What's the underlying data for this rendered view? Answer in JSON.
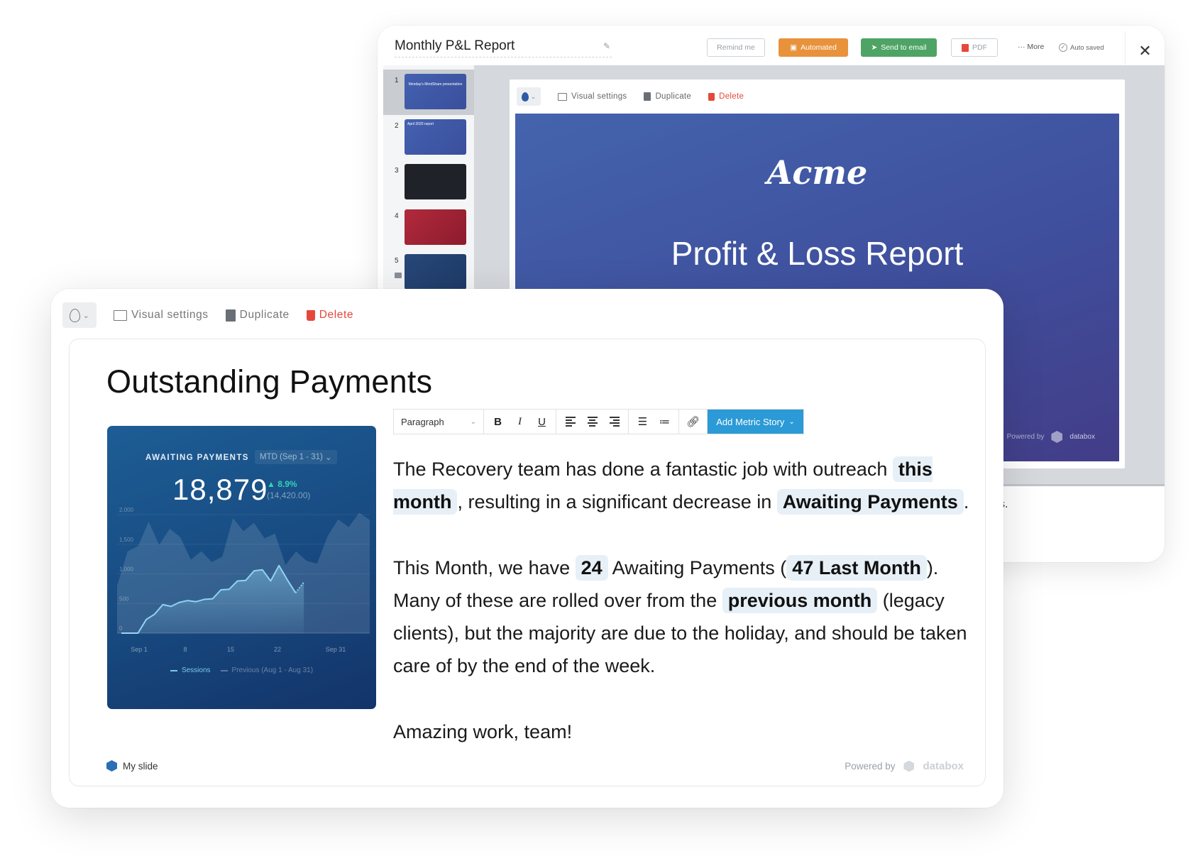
{
  "back_window": {
    "title": "Monthly P&L Report",
    "buttons": {
      "remind": "Remind me",
      "automated": "Automated",
      "send_email": "Send to email",
      "pdf": "PDF",
      "more": "More",
      "auto_saved": "Auto saved"
    },
    "thumbnails": [
      {
        "number": "1",
        "caption": "Monday's MindShare presentation"
      },
      {
        "number": "2",
        "caption": "April 2020 report"
      },
      {
        "number": "3",
        "caption": ""
      },
      {
        "number": "4",
        "caption": ""
      },
      {
        "number": "5",
        "caption": ""
      }
    ],
    "slide_toolbar": {
      "visual_settings": "Visual settings",
      "duplicate": "Duplicate",
      "delete": "Delete"
    },
    "slide": {
      "logo": "Acme",
      "title": "Profit & Loss Report",
      "powered_by": "Powered by",
      "brand": "databox"
    },
    "partial_text": "s."
  },
  "front_window": {
    "toolbar": {
      "visual_settings": "Visual settings",
      "duplicate": "Duplicate",
      "delete": "Delete"
    },
    "title": "Outstanding Payments",
    "metric": {
      "label": "AWAITING PAYMENTS",
      "range": "MTD (Sep 1 - 31)",
      "value": "18,879",
      "change": "▲ 8.9%",
      "previous": "(14,420.00)",
      "y_ticks": [
        "0",
        "500",
        "1,000",
        "1,500",
        "2,000"
      ],
      "x_ticks": [
        "Sep 1",
        "8",
        "15",
        "22",
        "Sep 31"
      ],
      "legend": {
        "current": "Sessions",
        "previous": "Previous (Aug 1 - Aug 31)"
      }
    },
    "editor": {
      "paragraph": "Paragraph",
      "bold": "B",
      "italic": "I",
      "underline": "U",
      "add_metric": "Add Metric Story"
    },
    "body": {
      "p1_a": "The Recovery team has done a fantastic job with outreach ",
      "p1_chip1": "this month",
      "p1_b": ", resulting in a significant decrease in ",
      "p1_chip2": "Awaiting Payments",
      "p1_c": ".",
      "p2_a": "This Month, we have ",
      "p2_chip1": "24",
      "p2_b": " Awaiting Payments (",
      "p2_chip2": "47 Last Month",
      "p2_c": "). Many of these are rolled over from the ",
      "p2_chip3": "previous month",
      "p2_d": " (legacy clients), but the majority are due to the holiday, and should be taken care of by the end of the week.",
      "p3": "Amazing work, team!"
    },
    "footer": {
      "slide_name": "My slide",
      "powered_by": "Powered by",
      "brand": "databox"
    }
  },
  "chart_data": {
    "type": "area",
    "title": "AWAITING PAYMENTS",
    "xlabel": "",
    "ylabel": "",
    "ylim": [
      0,
      2000
    ],
    "x_tick_labels": [
      "Sep 1",
      "8",
      "15",
      "22",
      "Sep 31"
    ],
    "series": [
      {
        "name": "Sessions",
        "values": [
          0,
          0,
          0,
          230,
          320,
          480,
          450,
          520,
          550,
          530,
          570,
          580,
          730,
          740,
          880,
          890,
          1050,
          1070,
          880,
          1140,
          900,
          680,
          860
        ]
      },
      {
        "name": "Previous (Aug 1 - Aug 31)",
        "values": [
          800,
          1380,
          1470,
          1880,
          1490,
          1760,
          1620,
          1240,
          1380,
          1200,
          1290,
          1940,
          1720,
          1860,
          1600,
          1680,
          1150,
          1380,
          1220,
          1170,
          1640,
          1920,
          1790,
          2030,
          1910
        ]
      }
    ]
  }
}
